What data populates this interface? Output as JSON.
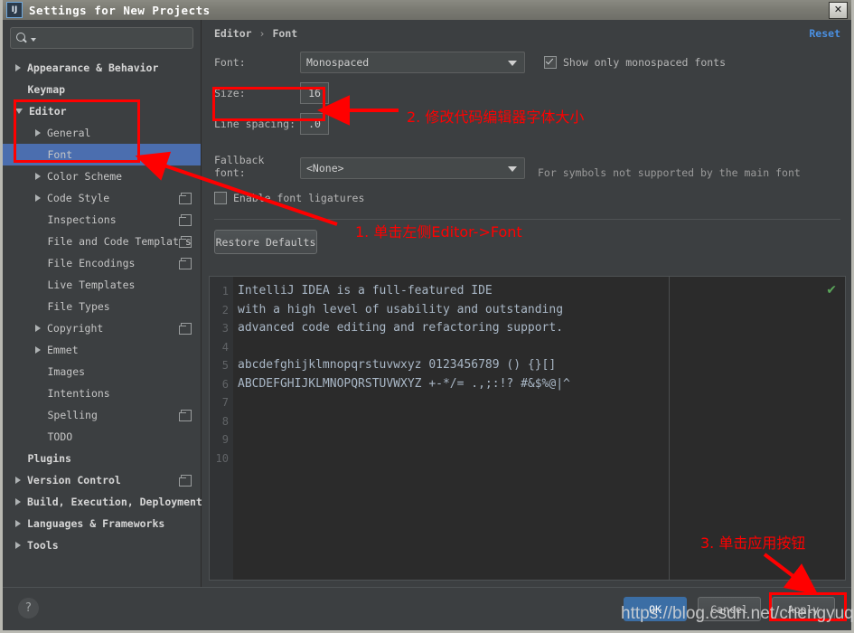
{
  "window": {
    "title": "Settings for New Projects",
    "icon_label": "IJ",
    "close_label": "✕"
  },
  "search": {
    "value": "",
    "placeholder": ""
  },
  "sidebar": {
    "items": [
      {
        "label": "Appearance & Behavior",
        "arrow": "closed",
        "indent": 0,
        "bold": true,
        "copy": false,
        "selected": false
      },
      {
        "label": "Keymap",
        "arrow": "none",
        "indent": 0,
        "bold": true,
        "copy": false,
        "selected": false
      },
      {
        "label": "Editor",
        "arrow": "open",
        "indent": 0,
        "bold": true,
        "copy": false,
        "selected": false
      },
      {
        "label": "General",
        "arrow": "closed",
        "indent": 1,
        "bold": false,
        "copy": false,
        "selected": false
      },
      {
        "label": "Font",
        "arrow": "none",
        "indent": 1,
        "bold": false,
        "copy": false,
        "selected": true
      },
      {
        "label": "Color Scheme",
        "arrow": "closed",
        "indent": 1,
        "bold": false,
        "copy": false,
        "selected": false
      },
      {
        "label": "Code Style",
        "arrow": "closed",
        "indent": 1,
        "bold": false,
        "copy": true,
        "selected": false
      },
      {
        "label": "Inspections",
        "arrow": "none",
        "indent": 1,
        "bold": false,
        "copy": true,
        "selected": false
      },
      {
        "label": "File and Code Templates",
        "arrow": "none",
        "indent": 1,
        "bold": false,
        "copy": true,
        "selected": false
      },
      {
        "label": "File Encodings",
        "arrow": "none",
        "indent": 1,
        "bold": false,
        "copy": true,
        "selected": false
      },
      {
        "label": "Live Templates",
        "arrow": "none",
        "indent": 1,
        "bold": false,
        "copy": false,
        "selected": false
      },
      {
        "label": "File Types",
        "arrow": "none",
        "indent": 1,
        "bold": false,
        "copy": false,
        "selected": false
      },
      {
        "label": "Copyright",
        "arrow": "closed",
        "indent": 1,
        "bold": false,
        "copy": true,
        "selected": false
      },
      {
        "label": "Emmet",
        "arrow": "closed",
        "indent": 1,
        "bold": false,
        "copy": false,
        "selected": false
      },
      {
        "label": "Images",
        "arrow": "none",
        "indent": 1,
        "bold": false,
        "copy": false,
        "selected": false
      },
      {
        "label": "Intentions",
        "arrow": "none",
        "indent": 1,
        "bold": false,
        "copy": false,
        "selected": false
      },
      {
        "label": "Spelling",
        "arrow": "none",
        "indent": 1,
        "bold": false,
        "copy": true,
        "selected": false
      },
      {
        "label": "TODO",
        "arrow": "none",
        "indent": 1,
        "bold": false,
        "copy": false,
        "selected": false
      },
      {
        "label": "Plugins",
        "arrow": "none",
        "indent": 0,
        "bold": true,
        "copy": false,
        "selected": false
      },
      {
        "label": "Version Control",
        "arrow": "closed",
        "indent": 0,
        "bold": true,
        "copy": true,
        "selected": false
      },
      {
        "label": "Build, Execution, Deployment",
        "arrow": "closed",
        "indent": 0,
        "bold": true,
        "copy": false,
        "selected": false
      },
      {
        "label": "Languages & Frameworks",
        "arrow": "closed",
        "indent": 0,
        "bold": true,
        "copy": false,
        "selected": false
      },
      {
        "label": "Tools",
        "arrow": "closed",
        "indent": 0,
        "bold": true,
        "copy": false,
        "selected": false
      }
    ]
  },
  "breadcrumb": {
    "root": "Editor",
    "separator": "›",
    "leaf": "Font",
    "reset_label": "Reset"
  },
  "form": {
    "font_label": "Font:",
    "font_value": "Monospaced",
    "show_monospaced_label": "Show only monospaced fonts",
    "show_monospaced_checked": true,
    "size_label": "Size:",
    "size_value": "16",
    "line_spacing_label": "Line spacing:",
    "line_spacing_value": ".0",
    "fallback_label": "Fallback font:",
    "fallback_value": "<None>",
    "fallback_hint": "For symbols not supported by the main font",
    "ligatures_label": "Enable font ligatures",
    "ligatures_checked": false,
    "restore_defaults_label": "Restore Defaults"
  },
  "preview": {
    "line_numbers": [
      "1",
      "2",
      "3",
      "4",
      "5",
      "6",
      "7",
      "8",
      "9",
      "10"
    ],
    "code_lines": [
      "IntelliJ IDEA is a full-featured IDE",
      "with a high level of usability and outstanding",
      "advanced code editing and refactoring support.",
      "",
      "abcdefghijklmnopqrstuvwxyz 0123456789 () {}[]",
      "ABCDEFGHIJKLMNOPQRSTUVWXYZ +-*/= .,;:!? #&$%@|^",
      "",
      "",
      "",
      ""
    ],
    "status_icon": "✔"
  },
  "footer": {
    "help_label": "?",
    "ok_label": "OK",
    "cancel_label": "Cancel",
    "apply_label": "Apply"
  },
  "annotations": {
    "step1": "1. 单击左侧Editor->Font",
    "step2": "2. 修改代码编辑器字体大小",
    "step3": "3. 单击应用按钮",
    "color": "#ff0000"
  },
  "watermark": {
    "text": "https://blog.csdn.net/chengyuqiang"
  }
}
